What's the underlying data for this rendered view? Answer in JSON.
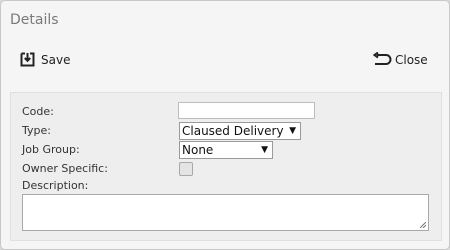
{
  "dialog": {
    "title": "Details"
  },
  "toolbar": {
    "save_label": "Save",
    "close_label": "Close",
    "save_icon": "save-icon",
    "close_icon": "close-arrow-icon"
  },
  "form": {
    "code": {
      "label": "Code:",
      "value": ""
    },
    "type": {
      "label": "Type:",
      "value": "Claused Delivery"
    },
    "job_group": {
      "label": "Job Group:",
      "value": "None"
    },
    "owner_specific": {
      "label": "Owner Specific:",
      "checked": false
    },
    "description": {
      "label": "Description:",
      "value": ""
    }
  }
}
